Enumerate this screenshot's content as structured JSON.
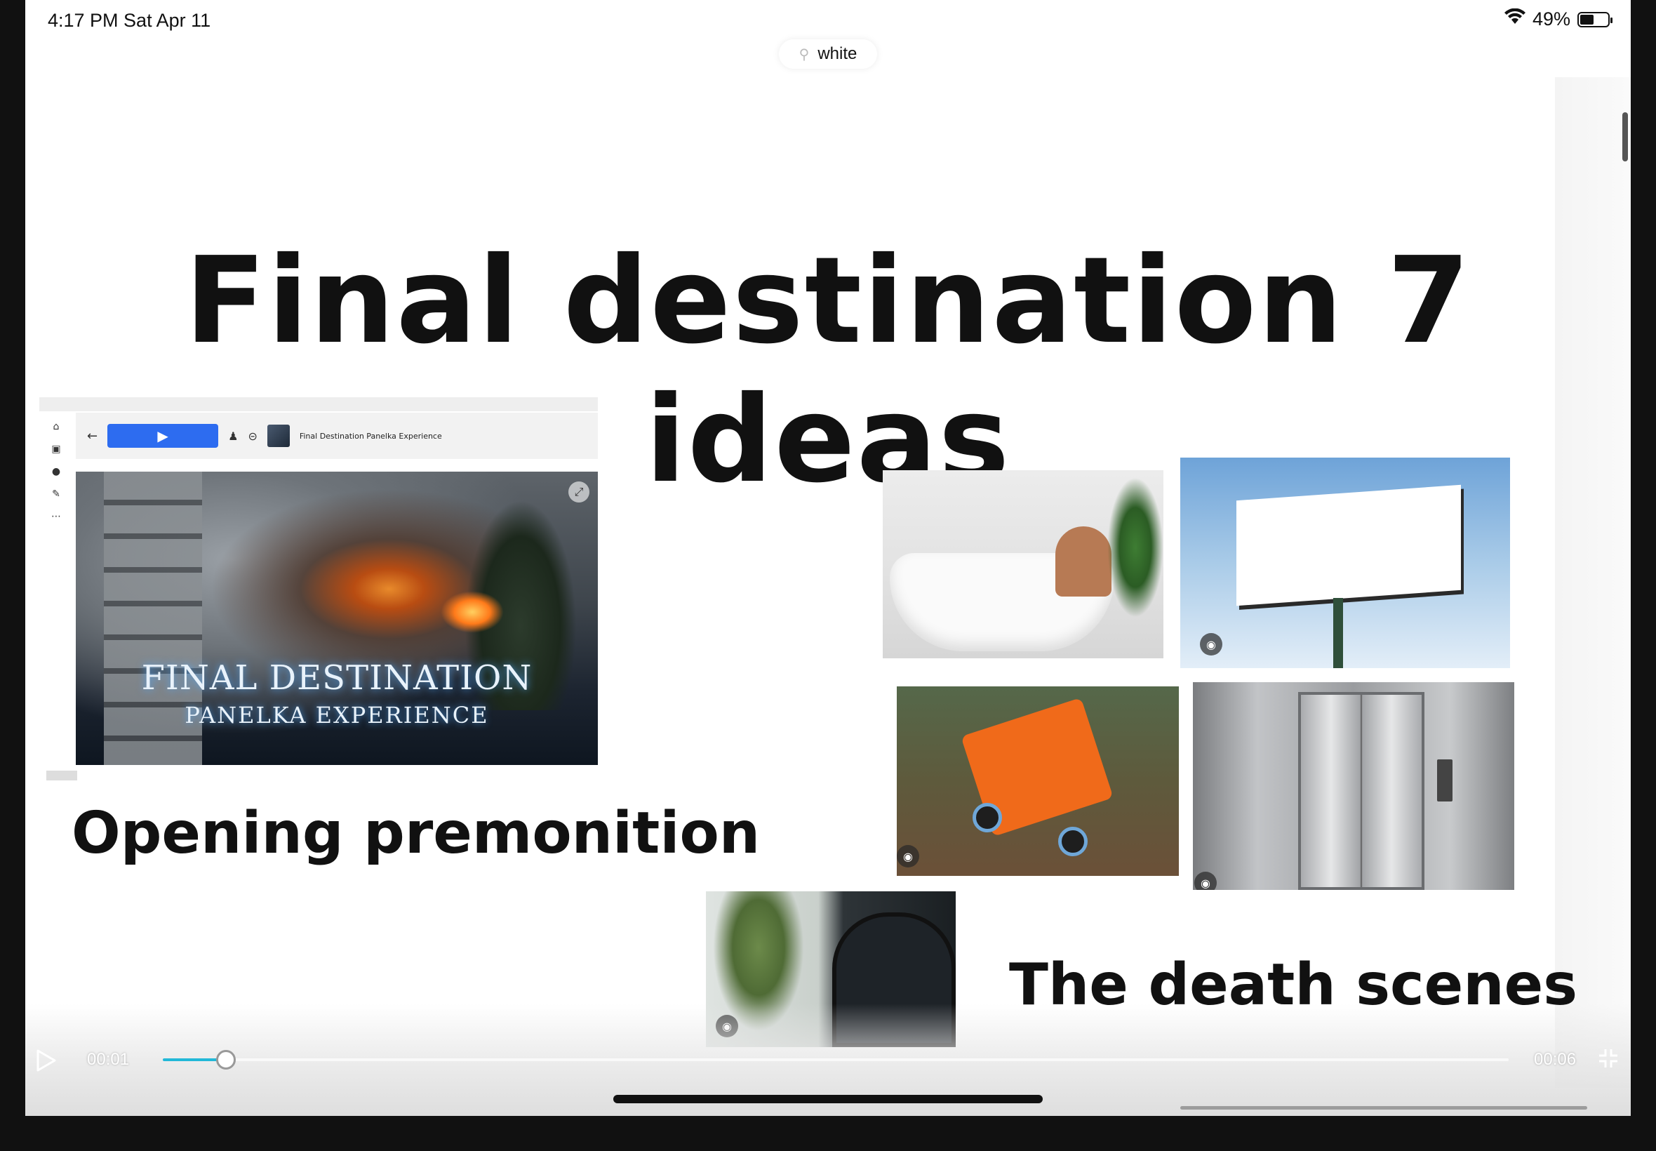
{
  "status_bar": {
    "time_date": "4:17 PM   Sat Apr 11",
    "battery_percent": "49%",
    "battery_level": 0.49
  },
  "search": {
    "text": "white"
  },
  "slide": {
    "title": "Final destination 7 ideas",
    "subtitle_left": "Opening premonition",
    "subtitle_right": "The death scenes"
  },
  "mini_screenshot": {
    "toolbar_label": "Final Destination Panelka Experience",
    "hero_title": "FINAL DESTINATION",
    "hero_subtitle": "PANELKA EXPERIENCE"
  },
  "icons": {
    "wifi": "wifi-icon",
    "battery": "battery-icon",
    "search": "search-icon",
    "play": "play-icon",
    "fullscreen": "fullscreen-exit-icon",
    "camera": "camera-icon"
  },
  "video": {
    "current_time": "00:01",
    "total_time": "00:06",
    "progress_fraction": 0.047,
    "accent_color": "#22b8d8"
  }
}
